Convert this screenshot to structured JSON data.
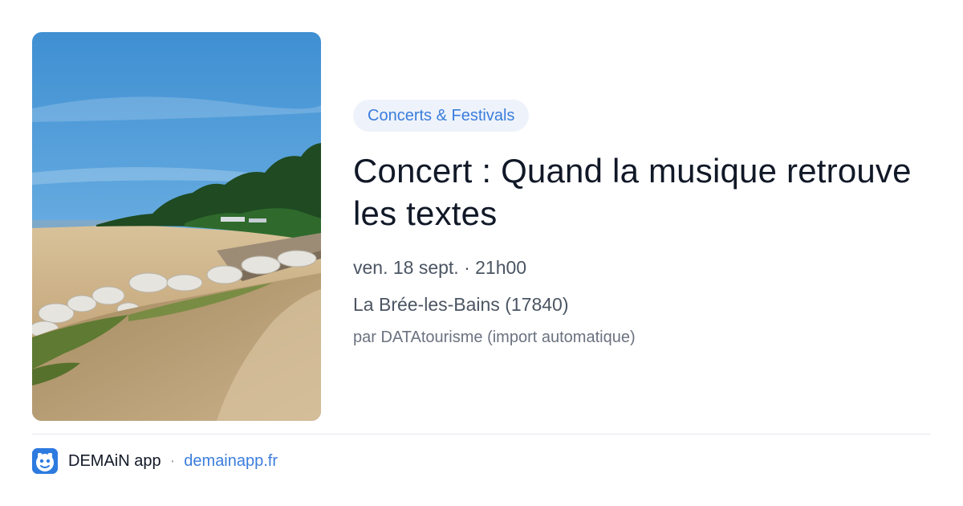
{
  "event": {
    "category": "Concerts & Festivals",
    "title": "Concert : Quand la musique retrouve les textes",
    "date_time": "ven. 18 sept. · 21h00",
    "location": "La Brée-les-Bains (17840)",
    "source": "par DATAtourisme (import automatique)"
  },
  "footer": {
    "app_name": "DEMAiN app",
    "separator": "·",
    "app_url": "demainapp.fr"
  },
  "colors": {
    "accent": "#3b7ddd",
    "category_bg": "#eef3fb",
    "title": "#111827",
    "meta": "#4b5563",
    "muted": "#6b7280"
  },
  "icons": {
    "app": "demain-app-icon"
  }
}
